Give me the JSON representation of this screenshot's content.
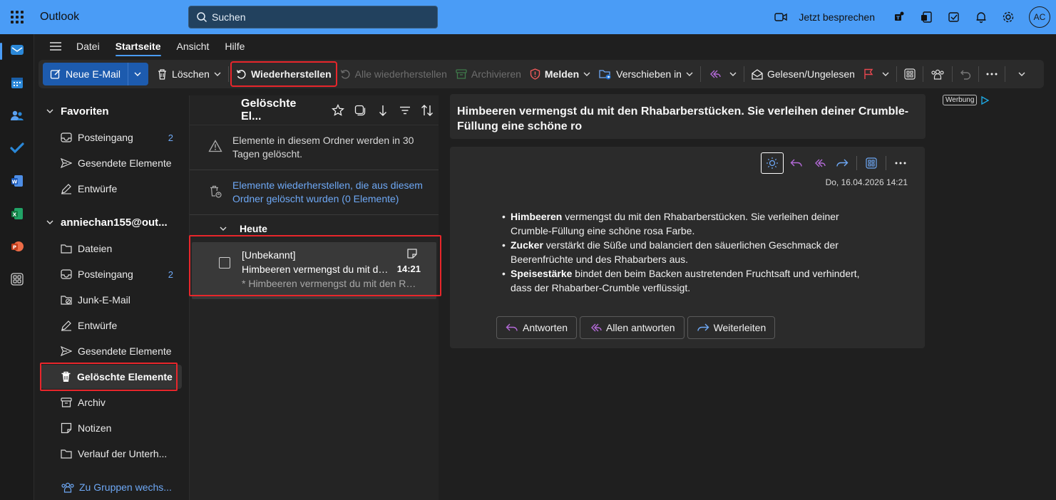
{
  "app": {
    "title": "Outlook",
    "user_initials": "AC"
  },
  "search": {
    "placeholder": "Suchen"
  },
  "topbar": {
    "talk_label": "Jetzt besprechen"
  },
  "menu": {
    "tabs": [
      "Datei",
      "Startseite",
      "Ansicht",
      "Hilfe"
    ],
    "active": "Startseite"
  },
  "ribbon": {
    "new_mail": "Neue E-Mail",
    "delete": "Löschen",
    "restore": "Wiederherstellen",
    "restore_all": "Alle wiederherstellen",
    "archive": "Archivieren",
    "report": "Melden",
    "move_to": "Verschieben in",
    "read_unread": "Gelesen/Ungelesen"
  },
  "folders": {
    "favorites_header": "Favoriten",
    "favorites": [
      {
        "label": "Posteingang",
        "count": "2",
        "icon": "inbox-icon"
      },
      {
        "label": "Gesendete Elemente",
        "count": "",
        "icon": "send-icon"
      },
      {
        "label": "Entwürfe",
        "count": "",
        "icon": "draft-icon"
      }
    ],
    "account_header": "anniechan155@out...",
    "account_items": [
      {
        "label": "Dateien",
        "count": "",
        "icon": "folder-icon"
      },
      {
        "label": "Posteingang",
        "count": "2",
        "icon": "inbox-icon"
      },
      {
        "label": "Junk-E-Mail",
        "count": "",
        "icon": "junk-icon"
      },
      {
        "label": "Entwürfe",
        "count": "",
        "icon": "draft-icon"
      },
      {
        "label": "Gesendete Elemente",
        "count": "",
        "icon": "send-icon"
      },
      {
        "label": "Gelöschte Elemente",
        "count": "",
        "icon": "trash-icon",
        "selected": true
      },
      {
        "label": "Archiv",
        "count": "",
        "icon": "archive-icon"
      },
      {
        "label": "Notizen",
        "count": "",
        "icon": "note-icon"
      },
      {
        "label": "Verlauf der Unterh...",
        "count": "",
        "icon": "folder-icon"
      }
    ],
    "groups_link": "Zu Gruppen wechs..."
  },
  "message_list": {
    "title": "Gelöschte El...",
    "notice": "Elemente in diesem Ordner werden in 30 Tagen gelöscht.",
    "recover_link": "Elemente wiederherstellen, die aus diesem Ordner gelöscht wurden (0 Elemente)",
    "group": "Heute",
    "messages": [
      {
        "from": "[Unbekannt]",
        "subject": "Himbeeren vermengst du mit den Rhabarberstücken",
        "preview": "* Himbeeren vermengst du mit den Rhabarberstücken",
        "time": "14:21"
      }
    ]
  },
  "reading": {
    "subject": "Himbeeren vermengst du mit den Rhabarberstücken. Sie verleihen deiner Crumble-Füllung eine schöne ro",
    "date": "Do, 16.04.2026 14:21",
    "bullets": [
      {
        "bold": "Himbeeren",
        "text": " vermengst du mit den Rhabarberstücken. Sie verleihen deiner Crumble-Füllung eine schöne rosa Farbe."
      },
      {
        "bold": "Zucker",
        "text": " verstärkt die Süße und balanciert den säuerlichen Geschmack der Beerenfrüchte und des Rhabarbers aus."
      },
      {
        "bold": "Speisestärke",
        "text": " bindet den beim Backen austretenden Fruchtsaft und verhindert, dass der Rhabarber-Crumble verflüssigt."
      }
    ],
    "reply": "Antworten",
    "reply_all": "Allen antworten",
    "forward": "Weiterleiten"
  },
  "ad": {
    "label": "Werbung"
  },
  "colors": {
    "accent": "#4a9cf6",
    "highlight": "#e8262b",
    "link": "#6ea8f5"
  }
}
